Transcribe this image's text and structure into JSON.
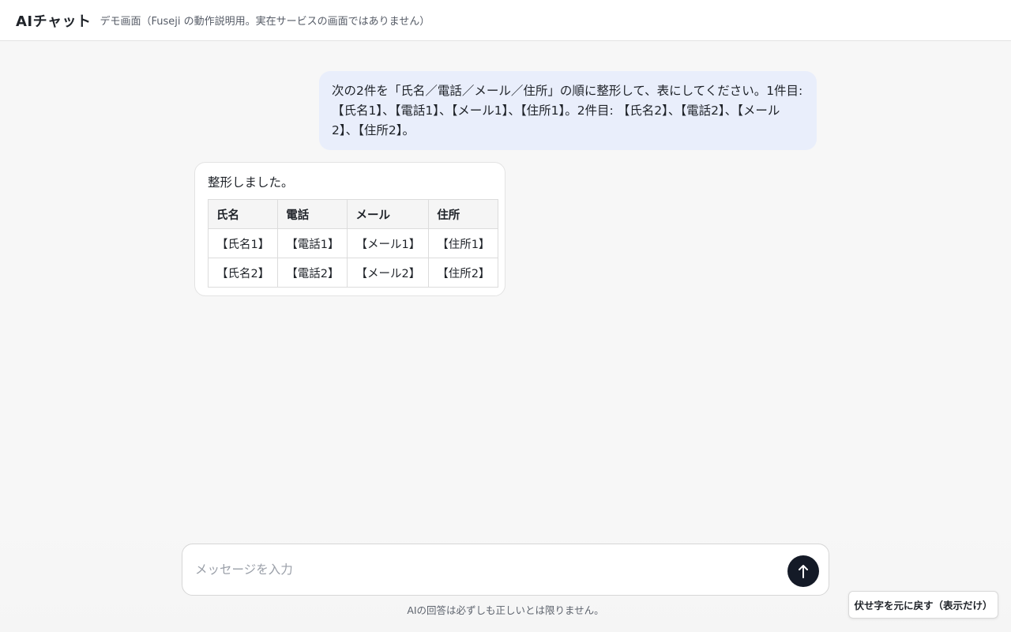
{
  "header": {
    "title": "AIチャット",
    "subtitle": "デモ画面（Fuseji の動作説明用。実在サービスの画面ではありません）"
  },
  "messages": {
    "user": "次の2件を「氏名／電話／メール／住所」の順に整形して、表にしてください。1件目: 【氏名1】、【電話1】、【メール1】、【住所1】。2件目: 【氏名2】、【電話2】、【メール2】、【住所2】。",
    "assistant": {
      "text": "整形しました。",
      "table": {
        "headers": [
          "氏名",
          "電話",
          "メール",
          "住所"
        ],
        "rows": [
          [
            "【氏名1】",
            "【電話1】",
            "【メール1】",
            "【住所1】"
          ],
          [
            "【氏名2】",
            "【電話2】",
            "【メール2】",
            "【住所2】"
          ]
        ]
      }
    }
  },
  "composer": {
    "placeholder": "メッセージを入力",
    "value": "",
    "send_icon": "arrow-up-icon",
    "disclaimer": "AIの回答は必ずしも正しいとは限りません。"
  },
  "restore_button": {
    "label": "伏せ字を元に戻す（表示だけ）"
  },
  "colors": {
    "user_bubble": "#e9eefb",
    "send_button": "#141a27",
    "background": "#f7f7f7"
  }
}
